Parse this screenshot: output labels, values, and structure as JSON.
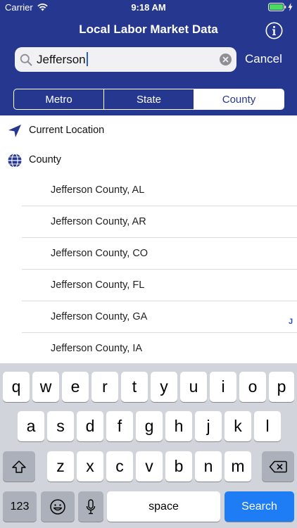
{
  "status_bar": {
    "carrier": "Carrier",
    "time": "9:18 AM"
  },
  "nav": {
    "title": "Local Labor Market Data",
    "info_icon": "info-icon"
  },
  "search": {
    "value": "Jefferson",
    "cancel_label": "Cancel"
  },
  "segments": [
    {
      "label": "Metro",
      "selected": false
    },
    {
      "label": "State",
      "selected": false
    },
    {
      "label": "County",
      "selected": true
    }
  ],
  "sections": {
    "current_location": "Current Location",
    "county_header": "County"
  },
  "results": [
    "Jefferson County, AL",
    "Jefferson County, AR",
    "Jefferson County, CO",
    "Jefferson County, FL",
    "Jefferson County, GA",
    "Jefferson County, IA"
  ],
  "section_index": [
    "J"
  ],
  "keyboard": {
    "row1": [
      "q",
      "w",
      "e",
      "r",
      "t",
      "y",
      "u",
      "i",
      "o",
      "p"
    ],
    "row2": [
      "a",
      "s",
      "d",
      "f",
      "g",
      "h",
      "j",
      "k",
      "l"
    ],
    "row3": [
      "z",
      "x",
      "c",
      "v",
      "b",
      "n",
      "m"
    ],
    "numbers_label": "123",
    "space_label": "space",
    "search_label": "Search"
  },
  "colors": {
    "brand": "#26378f",
    "search_key": "#1e7cf5",
    "keyboard_bg": "#d1d4da"
  }
}
